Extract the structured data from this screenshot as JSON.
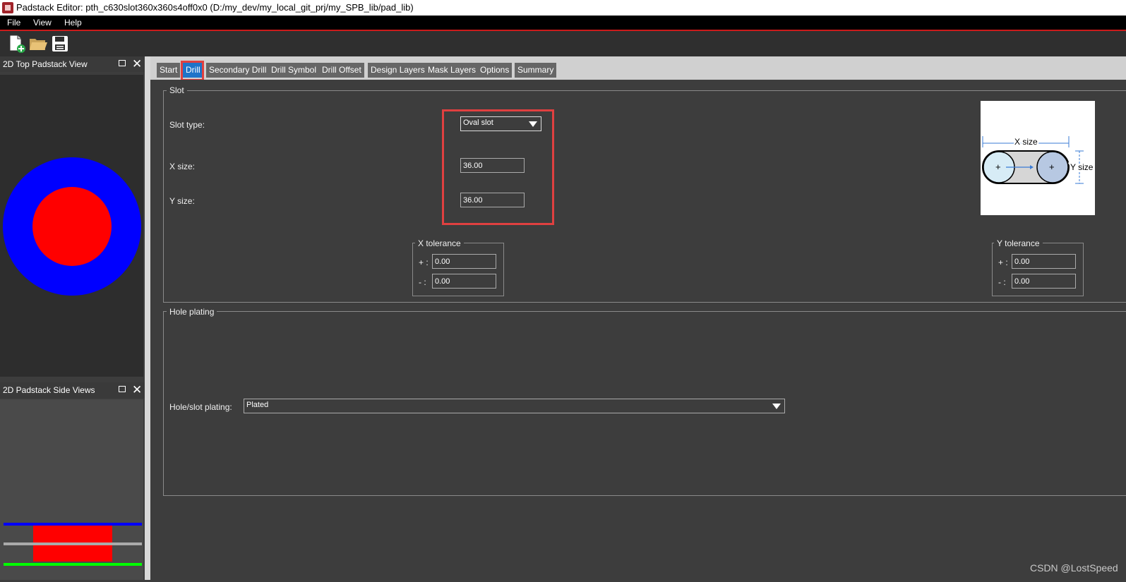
{
  "window": {
    "title": "Padstack Editor: pth_c630slot360x360s4off0x0  (D:/my_dev/my_local_git_prj/my_SPB_lib/pad_lib)"
  },
  "menu": [
    "File",
    "View",
    "Help"
  ],
  "toolbar": {
    "icons": [
      "new-file-icon",
      "open-folder-icon",
      "save-icon"
    ]
  },
  "docks": {
    "top_view": {
      "title": "2D Top Padstack View"
    },
    "side_view": {
      "title": "2D Padstack Side Views"
    }
  },
  "tabs": [
    {
      "label": "Start",
      "active": false
    },
    {
      "label": "Drill",
      "active": true
    },
    {
      "label": "Secondary Drill",
      "active": false
    },
    {
      "label": "Drill Symbol",
      "active": false
    },
    {
      "label": "Drill Offset",
      "active": false
    },
    {
      "label": "Design Layers",
      "active": false
    },
    {
      "label": "Mask Layers",
      "active": false
    },
    {
      "label": "Options",
      "active": false
    },
    {
      "label": "Summary",
      "active": false
    }
  ],
  "slot": {
    "legend": "Slot",
    "slot_type_label": "Slot type:",
    "slot_type_value": "Oval slot",
    "x_size_label": "X size:",
    "x_size_value": "36.00",
    "y_size_label": "Y size:",
    "y_size_value": "36.00",
    "x_tolerance": {
      "legend": "X tolerance",
      "plus_label": "+ :",
      "plus_value": "0.00",
      "minus_label": "- :",
      "minus_value": "0.00"
    },
    "y_tolerance": {
      "legend": "Y tolerance",
      "plus_label": "+ :",
      "plus_value": "0.00",
      "minus_label": "- :",
      "minus_value": "0.00"
    },
    "diagram": {
      "x_label": "X size",
      "y_label": "Y size"
    }
  },
  "hole_plating": {
    "legend": "Hole plating",
    "label": "Hole/slot plating:",
    "value": "Plated"
  },
  "colors": {
    "pad_outer": "#0000ff",
    "pad_inner": "#ff0000",
    "side_top": "#0000ff",
    "side_mid": "#aaaaaa",
    "side_bottom": "#00ff00",
    "active_tab": "#1e74c9",
    "highlight": "#e04040"
  },
  "watermark": "CSDN @LostSpeed"
}
